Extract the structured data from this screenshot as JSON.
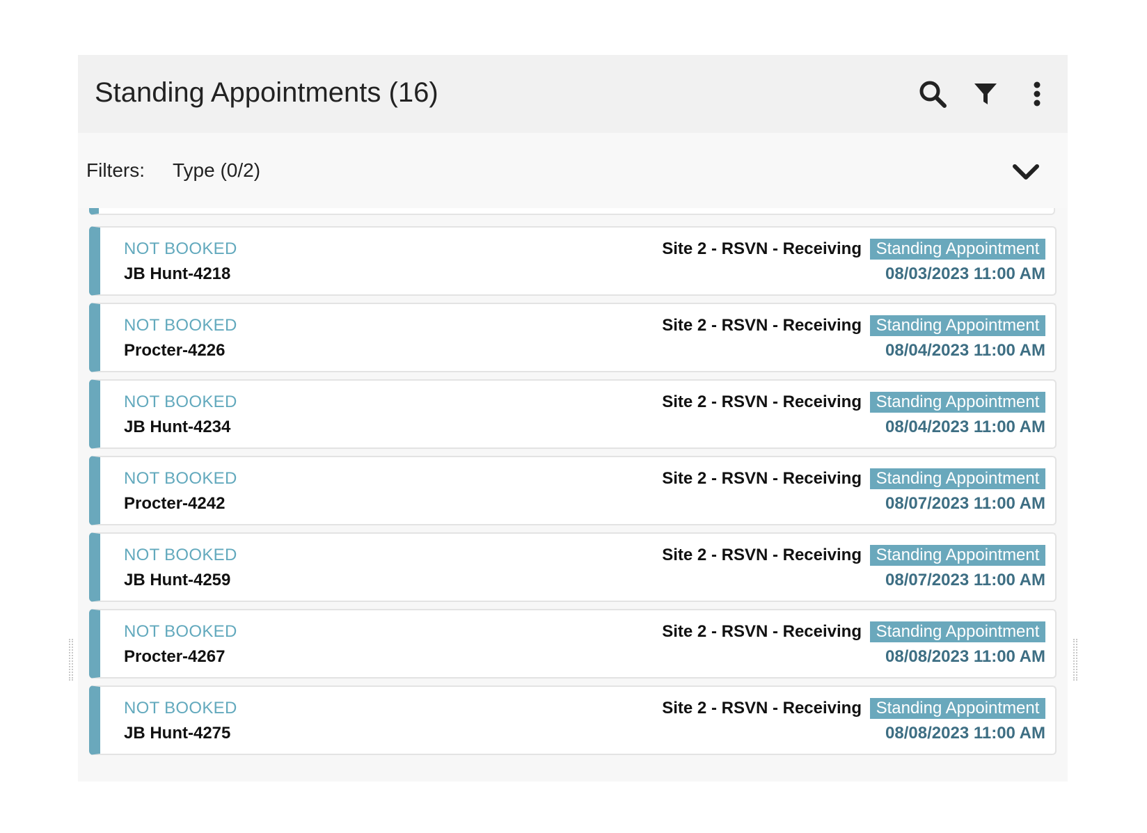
{
  "header": {
    "title": "Standing Appointments (16)",
    "icons": [
      "search-icon",
      "filter-icon",
      "more-vertical-icon"
    ]
  },
  "filters": {
    "label": "Filters:",
    "type_filter": "Type (0/2)",
    "expand_icon": "chevron-down-icon"
  },
  "colors": {
    "accent": "#6aa8bc",
    "status_text": "#62a9bd",
    "date_text": "#3d6e83",
    "header_bg": "#f1f1f1"
  },
  "appointments": [
    {
      "status": "NOT BOOKED",
      "carrier": "JB Hunt-4218",
      "location": "Site 2 - RSVN - Receiving",
      "type": "Standing Appointment",
      "datetime": "08/03/2023 11:00 AM"
    },
    {
      "status": "NOT BOOKED",
      "carrier": "Procter-4226",
      "location": "Site 2 - RSVN - Receiving",
      "type": "Standing Appointment",
      "datetime": "08/04/2023 11:00 AM"
    },
    {
      "status": "NOT BOOKED",
      "carrier": "JB Hunt-4234",
      "location": "Site 2 - RSVN - Receiving",
      "type": "Standing Appointment",
      "datetime": "08/04/2023 11:00 AM"
    },
    {
      "status": "NOT BOOKED",
      "carrier": "Procter-4242",
      "location": "Site 2 - RSVN - Receiving",
      "type": "Standing Appointment",
      "datetime": "08/07/2023 11:00 AM"
    },
    {
      "status": "NOT BOOKED",
      "carrier": "JB Hunt-4259",
      "location": "Site 2 - RSVN - Receiving",
      "type": "Standing Appointment",
      "datetime": "08/07/2023 11:00 AM"
    },
    {
      "status": "NOT BOOKED",
      "carrier": "Procter-4267",
      "location": "Site 2 - RSVN - Receiving",
      "type": "Standing Appointment",
      "datetime": "08/08/2023 11:00 AM"
    },
    {
      "status": "NOT BOOKED",
      "carrier": "JB Hunt-4275",
      "location": "Site 2 - RSVN - Receiving",
      "type": "Standing Appointment",
      "datetime": "08/08/2023 11:00 AM"
    }
  ]
}
